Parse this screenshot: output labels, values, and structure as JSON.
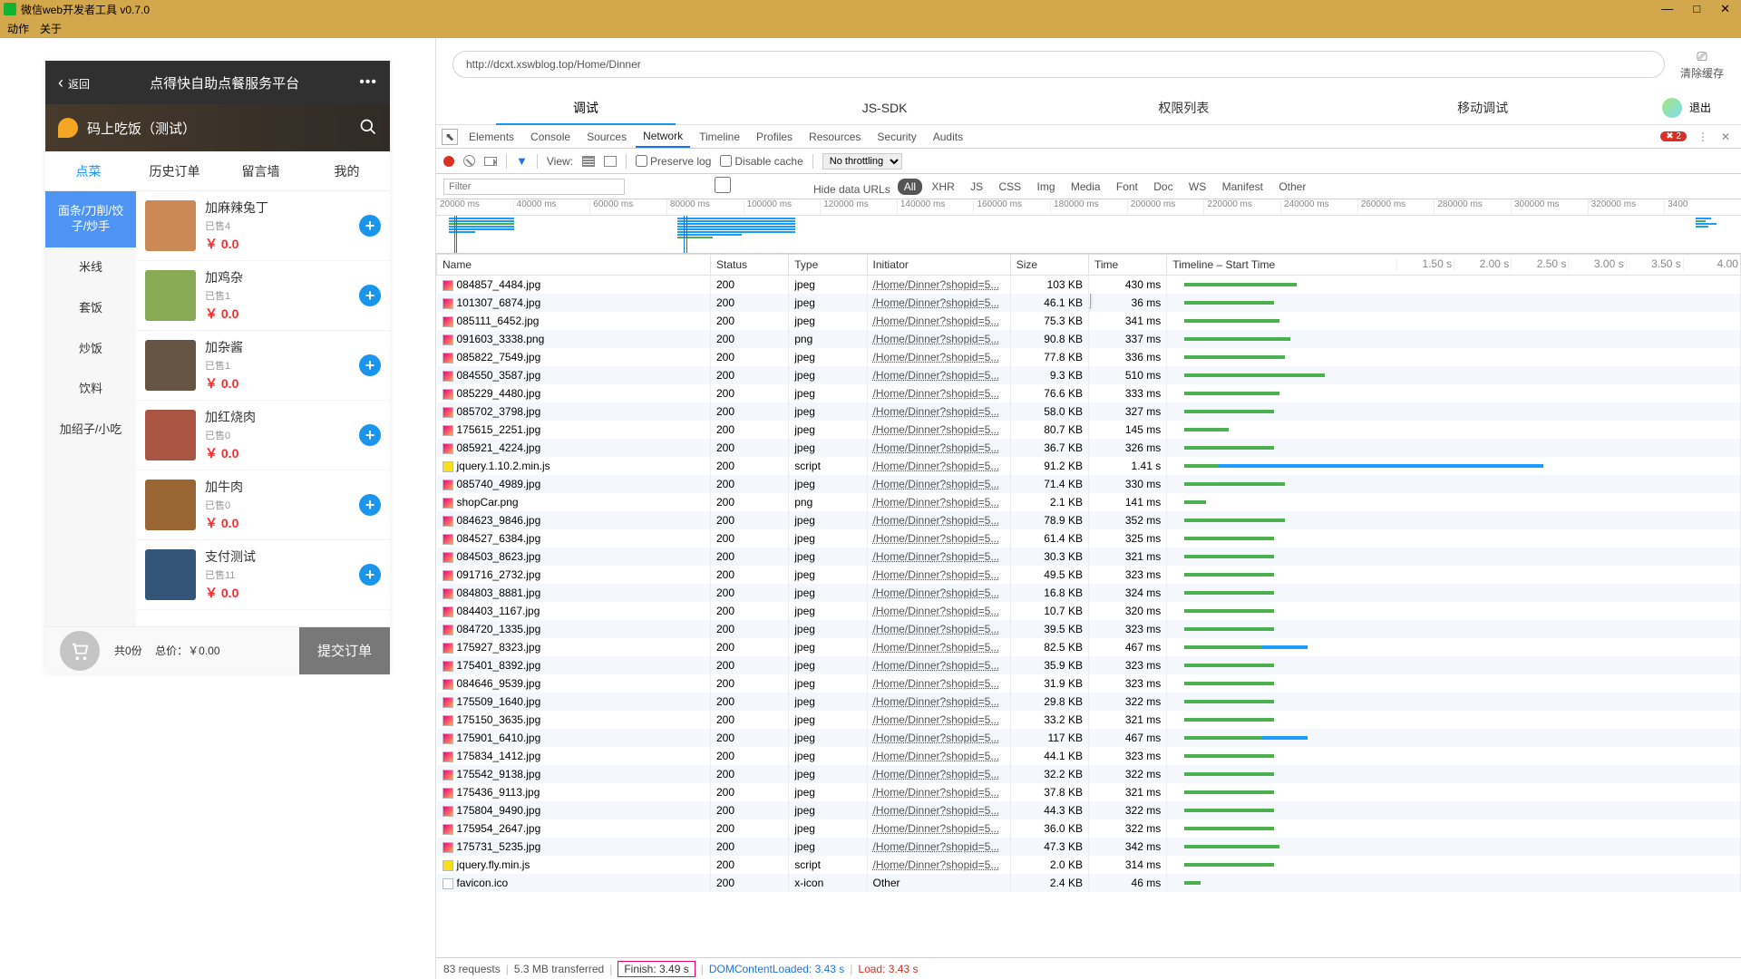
{
  "window": {
    "title": "微信web开发者工具 v0.7.0",
    "menu": [
      "动作",
      "关于"
    ],
    "controls": {
      "min": "—",
      "max": "□",
      "close": "✕"
    }
  },
  "urlbar": {
    "url": "http://dcxt.xswblog.top/Home/Dinner",
    "clear_cache": "清除缓存"
  },
  "mode_tabs": {
    "items": [
      "调试",
      "JS-SDK",
      "权限列表",
      "移动调试"
    ],
    "logout": "退出"
  },
  "devtools": {
    "tabs": [
      "Elements",
      "Console",
      "Sources",
      "Network",
      "Timeline",
      "Profiles",
      "Resources",
      "Security",
      "Audits"
    ],
    "active_tab": "Network",
    "errors_badge": "2",
    "toolbar": {
      "view": "View:",
      "preserve_log": "Preserve log",
      "disable_cache": "Disable cache",
      "throttle": "No throttling"
    },
    "filter": {
      "placeholder": "Filter",
      "hide_data": "Hide data URLs",
      "types": [
        "All",
        "XHR",
        "JS",
        "CSS",
        "Img",
        "Media",
        "Font",
        "Doc",
        "WS",
        "Manifest",
        "Other"
      ]
    },
    "overview_ticks": [
      "20000 ms",
      "40000 ms",
      "60000 ms",
      "80000 ms",
      "100000 ms",
      "120000 ms",
      "140000 ms",
      "160000 ms",
      "180000 ms",
      "200000 ms",
      "220000 ms",
      "240000 ms",
      "260000 ms",
      "280000 ms",
      "300000 ms",
      "320000 ms",
      "3400"
    ],
    "columns": {
      "name": "Name",
      "status": "Status",
      "type": "Type",
      "initiator": "Initiator",
      "size": "Size",
      "time": "Time",
      "timeline": "Timeline – Start Time"
    },
    "wf_ticks": [
      "1.50 s",
      "2.00 s",
      "2.50 s",
      "3.00 s",
      "3.50 s",
      "4.00"
    ],
    "size_tooltip": "103 KB",
    "requests": [
      {
        "name": "084857_4484.jpg",
        "status": "200",
        "type": "jpeg",
        "init": "/Home/Dinner?shopid=5...",
        "size": "103 KB",
        "time": "430 ms",
        "w": 20,
        "d": 0,
        "ico": "img"
      },
      {
        "name": "101307_6874.jpg",
        "status": "200",
        "type": "jpeg",
        "init": "/Home/Dinner?shopid=5...",
        "size": "46.1 KB",
        "time": "36 ms",
        "w": 16,
        "d": 0,
        "ico": "img"
      },
      {
        "name": "085111_6452.jpg",
        "status": "200",
        "type": "jpeg",
        "init": "/Home/Dinner?shopid=5...",
        "size": "75.3 KB",
        "time": "341 ms",
        "w": 17,
        "d": 0,
        "ico": "img"
      },
      {
        "name": "091603_3338.png",
        "status": "200",
        "type": "png",
        "init": "/Home/Dinner?shopid=5...",
        "size": "90.8 KB",
        "time": "337 ms",
        "w": 19,
        "d": 0,
        "ico": "img"
      },
      {
        "name": "085822_7549.jpg",
        "status": "200",
        "type": "jpeg",
        "init": "/Home/Dinner?shopid=5...",
        "size": "77.8 KB",
        "time": "336 ms",
        "w": 18,
        "d": 0,
        "ico": "img"
      },
      {
        "name": "084550_3587.jpg",
        "status": "200",
        "type": "jpeg",
        "init": "/Home/Dinner?shopid=5...",
        "size": "9.3 KB",
        "time": "510 ms",
        "w": 25,
        "d": 0,
        "ico": "img"
      },
      {
        "name": "085229_4480.jpg",
        "status": "200",
        "type": "jpeg",
        "init": "/Home/Dinner?shopid=5...",
        "size": "76.6 KB",
        "time": "333 ms",
        "w": 17,
        "d": 0,
        "ico": "img"
      },
      {
        "name": "085702_3798.jpg",
        "status": "200",
        "type": "jpeg",
        "init": "/Home/Dinner?shopid=5...",
        "size": "58.0 KB",
        "time": "327 ms",
        "w": 16,
        "d": 0,
        "ico": "img"
      },
      {
        "name": "175615_2251.jpg",
        "status": "200",
        "type": "jpeg",
        "init": "/Home/Dinner?shopid=5...",
        "size": "80.7 KB",
        "time": "145 ms",
        "w": 8,
        "d": 0,
        "ico": "img"
      },
      {
        "name": "085921_4224.jpg",
        "status": "200",
        "type": "jpeg",
        "init": "/Home/Dinner?shopid=5...",
        "size": "36.7 KB",
        "time": "326 ms",
        "w": 16,
        "d": 0,
        "ico": "img"
      },
      {
        "name": "jquery.1.10.2.min.js",
        "status": "200",
        "type": "script",
        "init": "/Home/Dinner?shopid=5...",
        "size": "91.2 KB",
        "time": "1.41 s",
        "w": 6,
        "d": 58,
        "ico": "js"
      },
      {
        "name": "085740_4989.jpg",
        "status": "200",
        "type": "jpeg",
        "init": "/Home/Dinner?shopid=5...",
        "size": "71.4 KB",
        "time": "330 ms",
        "w": 18,
        "d": 0,
        "ico": "img"
      },
      {
        "name": "shopCar.png",
        "status": "200",
        "type": "png",
        "init": "/Home/Dinner?shopid=5...",
        "size": "2.1 KB",
        "time": "141 ms",
        "w": 4,
        "d": 0,
        "ico": "img"
      },
      {
        "name": "084623_9846.jpg",
        "status": "200",
        "type": "jpeg",
        "init": "/Home/Dinner?shopid=5...",
        "size": "78.9 KB",
        "time": "352 ms",
        "w": 18,
        "d": 0,
        "ico": "img"
      },
      {
        "name": "084527_6384.jpg",
        "status": "200",
        "type": "jpeg",
        "init": "/Home/Dinner?shopid=5...",
        "size": "61.4 KB",
        "time": "325 ms",
        "w": 16,
        "d": 0,
        "ico": "img"
      },
      {
        "name": "084503_8623.jpg",
        "status": "200",
        "type": "jpeg",
        "init": "/Home/Dinner?shopid=5...",
        "size": "30.3 KB",
        "time": "321 ms",
        "w": 16,
        "d": 0,
        "ico": "img"
      },
      {
        "name": "091716_2732.jpg",
        "status": "200",
        "type": "jpeg",
        "init": "/Home/Dinner?shopid=5...",
        "size": "49.5 KB",
        "time": "323 ms",
        "w": 16,
        "d": 0,
        "ico": "img"
      },
      {
        "name": "084803_8881.jpg",
        "status": "200",
        "type": "jpeg",
        "init": "/Home/Dinner?shopid=5...",
        "size": "16.8 KB",
        "time": "324 ms",
        "w": 16,
        "d": 0,
        "ico": "img"
      },
      {
        "name": "084403_1167.jpg",
        "status": "200",
        "type": "jpeg",
        "init": "/Home/Dinner?shopid=5...",
        "size": "10.7 KB",
        "time": "320 ms",
        "w": 16,
        "d": 0,
        "ico": "img"
      },
      {
        "name": "084720_1335.jpg",
        "status": "200",
        "type": "jpeg",
        "init": "/Home/Dinner?shopid=5...",
        "size": "39.5 KB",
        "time": "323 ms",
        "w": 16,
        "d": 0,
        "ico": "img"
      },
      {
        "name": "175927_8323.jpg",
        "status": "200",
        "type": "jpeg",
        "init": "/Home/Dinner?shopid=5...",
        "size": "82.5 KB",
        "time": "467 ms",
        "w": 14,
        "d": 8,
        "ico": "img"
      },
      {
        "name": "175401_8392.jpg",
        "status": "200",
        "type": "jpeg",
        "init": "/Home/Dinner?shopid=5...",
        "size": "35.9 KB",
        "time": "323 ms",
        "w": 16,
        "d": 0,
        "ico": "img"
      },
      {
        "name": "084646_9539.jpg",
        "status": "200",
        "type": "jpeg",
        "init": "/Home/Dinner?shopid=5...",
        "size": "31.9 KB",
        "time": "323 ms",
        "w": 16,
        "d": 0,
        "ico": "img"
      },
      {
        "name": "175509_1640.jpg",
        "status": "200",
        "type": "jpeg",
        "init": "/Home/Dinner?shopid=5...",
        "size": "29.8 KB",
        "time": "322 ms",
        "w": 16,
        "d": 0,
        "ico": "img"
      },
      {
        "name": "175150_3635.jpg",
        "status": "200",
        "type": "jpeg",
        "init": "/Home/Dinner?shopid=5...",
        "size": "33.2 KB",
        "time": "321 ms",
        "w": 16,
        "d": 0,
        "ico": "img"
      },
      {
        "name": "175901_6410.jpg",
        "status": "200",
        "type": "jpeg",
        "init": "/Home/Dinner?shopid=5...",
        "size": "117 KB",
        "time": "467 ms",
        "w": 14,
        "d": 8,
        "ico": "img"
      },
      {
        "name": "175834_1412.jpg",
        "status": "200",
        "type": "jpeg",
        "init": "/Home/Dinner?shopid=5...",
        "size": "44.1 KB",
        "time": "323 ms",
        "w": 16,
        "d": 0,
        "ico": "img"
      },
      {
        "name": "175542_9138.jpg",
        "status": "200",
        "type": "jpeg",
        "init": "/Home/Dinner?shopid=5...",
        "size": "32.2 KB",
        "time": "322 ms",
        "w": 16,
        "d": 0,
        "ico": "img"
      },
      {
        "name": "175436_9113.jpg",
        "status": "200",
        "type": "jpeg",
        "init": "/Home/Dinner?shopid=5...",
        "size": "37.8 KB",
        "time": "321 ms",
        "w": 16,
        "d": 0,
        "ico": "img"
      },
      {
        "name": "175804_9490.jpg",
        "status": "200",
        "type": "jpeg",
        "init": "/Home/Dinner?shopid=5...",
        "size": "44.3 KB",
        "time": "322 ms",
        "w": 16,
        "d": 0,
        "ico": "img"
      },
      {
        "name": "175954_2647.jpg",
        "status": "200",
        "type": "jpeg",
        "init": "/Home/Dinner?shopid=5...",
        "size": "36.0 KB",
        "time": "322 ms",
        "w": 16,
        "d": 0,
        "ico": "img"
      },
      {
        "name": "175731_5235.jpg",
        "status": "200",
        "type": "jpeg",
        "init": "/Home/Dinner?shopid=5...",
        "size": "47.3 KB",
        "time": "342 ms",
        "w": 17,
        "d": 0,
        "ico": "img"
      },
      {
        "name": "jquery.fly.min.js",
        "status": "200",
        "type": "script",
        "init": "/Home/Dinner?shopid=5...",
        "size": "2.0 KB",
        "time": "314 ms",
        "w": 16,
        "d": 0,
        "ico": "js"
      },
      {
        "name": "favicon.ico",
        "status": "200",
        "type": "x-icon",
        "init": "Other",
        "size": "2.4 KB",
        "time": "46 ms",
        "w": 3,
        "d": 0,
        "ico": ""
      }
    ],
    "status": {
      "requests": "83 requests",
      "transferred": "5.3 MB transferred",
      "finish": "Finish: 3.49 s",
      "dcl": "DOMContentLoaded: 3.43 s",
      "load": "Load: 3.43 s"
    }
  },
  "phone": {
    "back": "返回",
    "header_title": "点得快自助点餐服务平台",
    "brand": "码上吃饭（测试）",
    "tabs": [
      "点菜",
      "历史订单",
      "留言墙",
      "我的"
    ],
    "categories": [
      "面条/刀削/饺子/炒手",
      "米线",
      "套饭",
      "炒饭",
      "饮料",
      "加绍子/小吃"
    ],
    "dishes": [
      {
        "name": "加麻辣兔丁",
        "sold": "已售4",
        "price": "￥ 0.0",
        "bg": "#c85"
      },
      {
        "name": "加鸡杂",
        "sold": "已售1",
        "price": "￥ 0.0",
        "bg": "#8a5"
      },
      {
        "name": "加杂酱",
        "sold": "已售1",
        "price": "￥ 0.0",
        "bg": "#654"
      },
      {
        "name": "加红烧肉",
        "sold": "已售0",
        "price": "￥ 0.0",
        "bg": "#a54"
      },
      {
        "name": "加牛肉",
        "sold": "已售0",
        "price": "￥ 0.0",
        "bg": "#963"
      },
      {
        "name": "支付测试",
        "sold": "已售11",
        "price": "￥ 0.0",
        "bg": "#357"
      }
    ],
    "footer": {
      "count": "共0份",
      "total_label": "总价：",
      "total": "￥0.00",
      "submit": "提交订单"
    }
  }
}
